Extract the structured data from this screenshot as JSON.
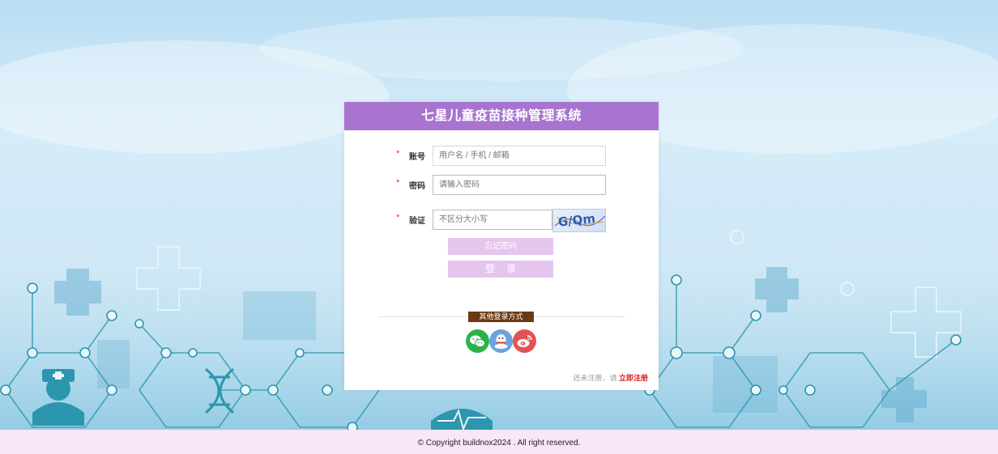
{
  "app": {
    "title": "七星儿童疫苗接种管理系统"
  },
  "form": {
    "account": {
      "required_mark": "*",
      "label": "账号",
      "placeholder": "用户名 / 手机 / 邮箱"
    },
    "password": {
      "required_mark": "*",
      "label": "密码",
      "placeholder": "请输入密码"
    },
    "captcha": {
      "required_mark": "*",
      "label": "验证",
      "placeholder": "不区分大小写",
      "image_text": "G/Qm"
    },
    "forgot_button": "忘记密码",
    "login_button": "登录"
  },
  "other_login": {
    "label": "其他登录方式",
    "providers": [
      {
        "name": "wechat",
        "icon": "wechat-icon",
        "color": "#2bb34b"
      },
      {
        "name": "qq",
        "icon": "qq-icon",
        "color": "#6aa3e0"
      },
      {
        "name": "weibo",
        "icon": "weibo-icon",
        "color": "#e35252"
      }
    ]
  },
  "register": {
    "prompt": "还未注册，请",
    "link": "立即注册"
  },
  "footer": {
    "copyright": "© Copyright buildnox2024 . All right reserved."
  },
  "colors": {
    "header": "#a874cf",
    "button": "#e6c5ef",
    "footer_bg": "#f9e6f7",
    "register_link": "#e02020"
  }
}
